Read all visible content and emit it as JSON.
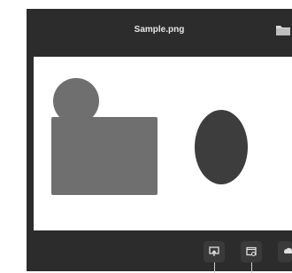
{
  "window": {
    "title": "Sample.png"
  },
  "toolbar": {
    "buttons": [
      {
        "icon": "export-icon"
      },
      {
        "icon": "settings-window-icon"
      },
      {
        "icon": "upload-icon"
      }
    ]
  },
  "colors": {
    "window_bg": "#2c2c2c",
    "canvas_bg": "#ffffff",
    "shape_light": "#6f6f6f",
    "shape_dark": "#3d3d3d",
    "title_text": "#e6e6e6"
  }
}
